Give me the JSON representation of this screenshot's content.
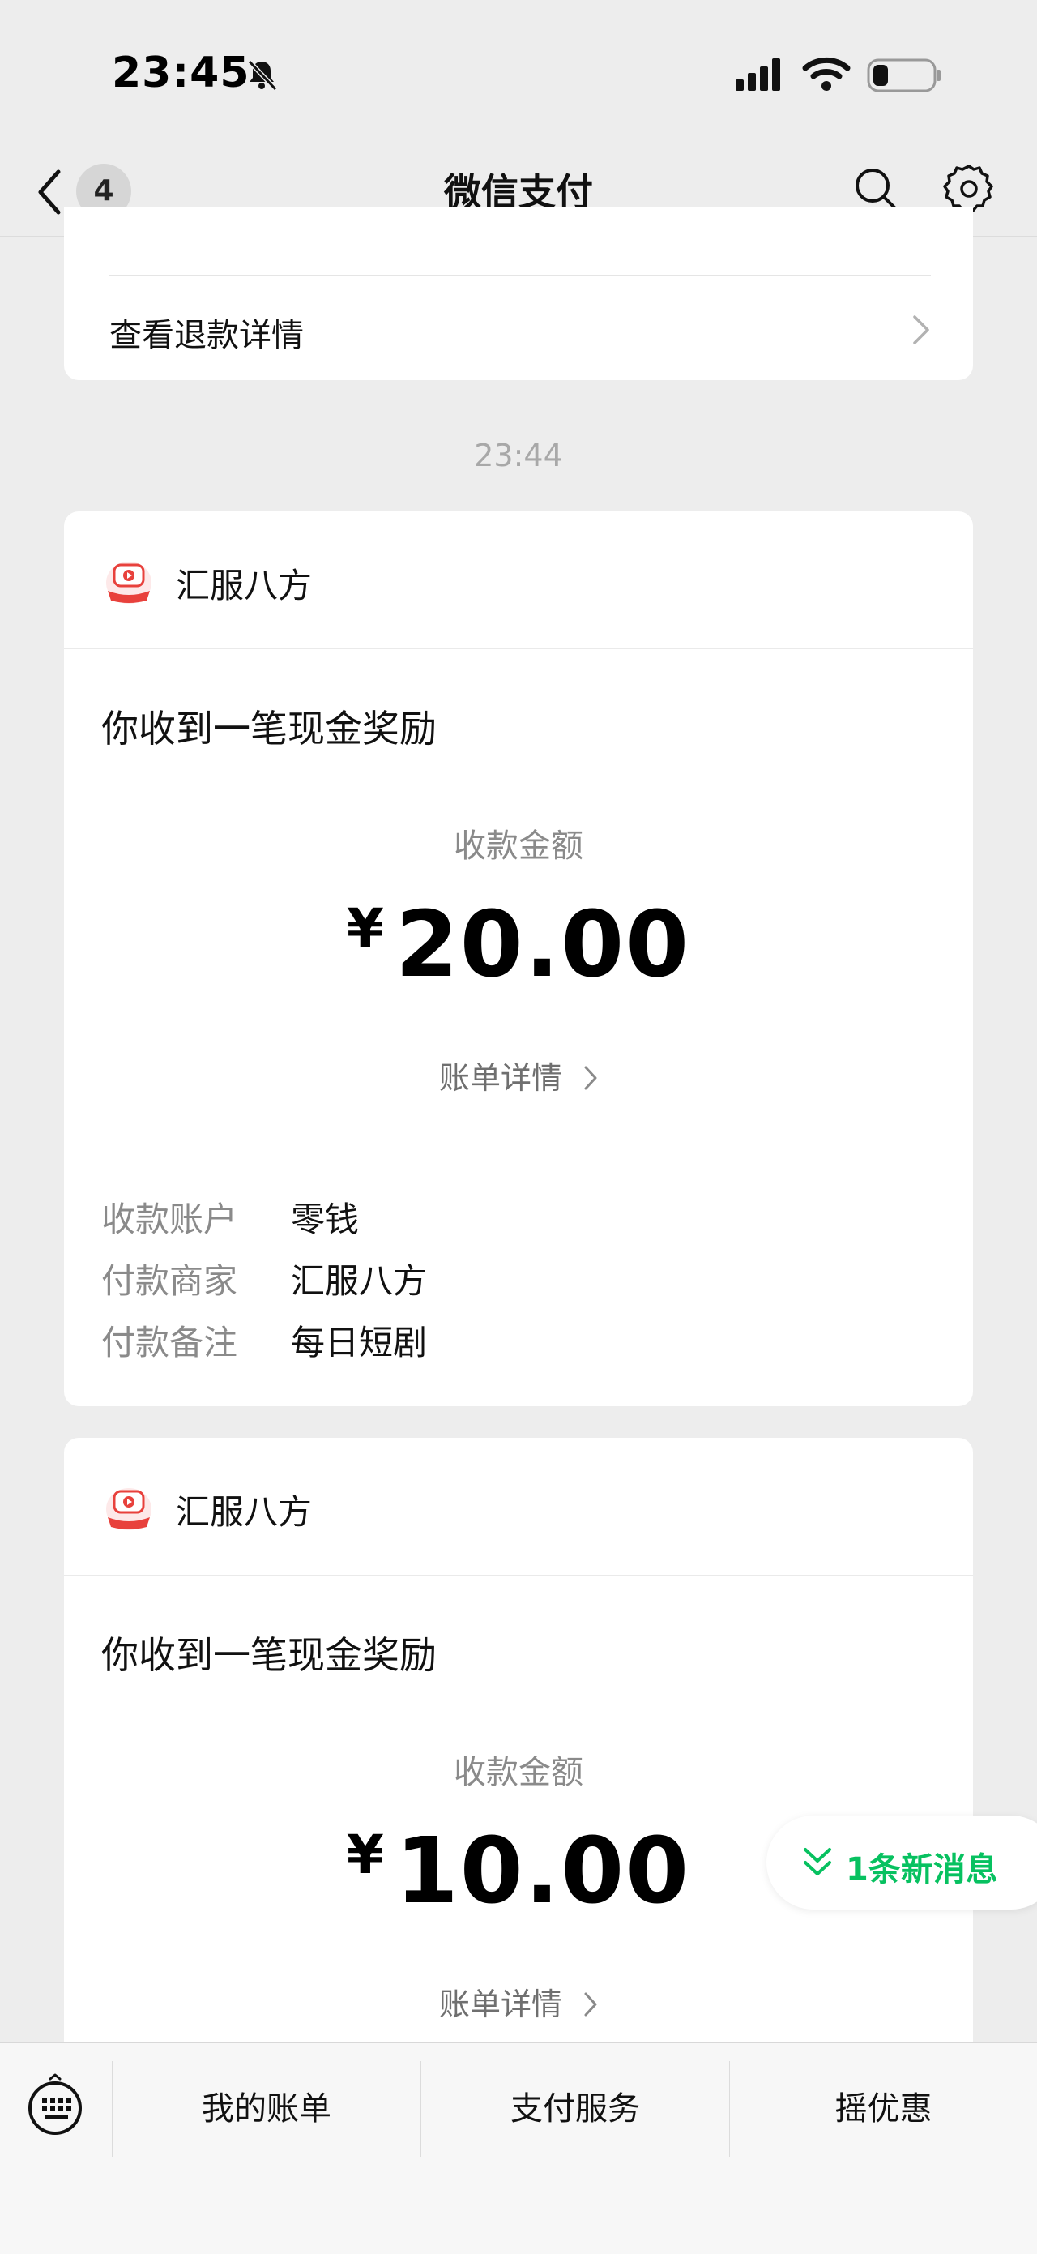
{
  "status_bar": {
    "time": "23:45",
    "icons": [
      "bell-muted-icon",
      "signal-icon",
      "wifi-icon",
      "battery-icon"
    ],
    "battery_level": 0.25
  },
  "nav": {
    "title": "微信支付",
    "unread_count": "4",
    "icons": [
      "back-chevron-icon",
      "search-icon",
      "gear-icon"
    ]
  },
  "refund": {
    "link_label": "查看退款详情"
  },
  "chat_time": "23:44",
  "messages": [
    {
      "merchant": "汇服八方",
      "title": "你收到一笔现金奖励",
      "amount_label": "收款金额",
      "currency": "¥",
      "amount": "20.00",
      "bill_link": "账单详情",
      "details": [
        {
          "key": "收款账户",
          "value": "零钱"
        },
        {
          "key": "付款商家",
          "value": "汇服八方"
        },
        {
          "key": "付款备注",
          "value": "每日短剧"
        }
      ]
    },
    {
      "merchant": "汇服八方",
      "title": "你收到一笔现金奖励",
      "amount_label": "收款金额",
      "currency": "¥",
      "amount": "10.00",
      "bill_link": "账单详情"
    }
  ],
  "new_message_pill": "1条新消息",
  "bottom_menu": {
    "items": [
      "我的账单",
      "支付服务",
      "摇优惠"
    ]
  },
  "colors": {
    "accent_green": "#07c160",
    "background": "#ededed",
    "card": "#ffffff"
  }
}
